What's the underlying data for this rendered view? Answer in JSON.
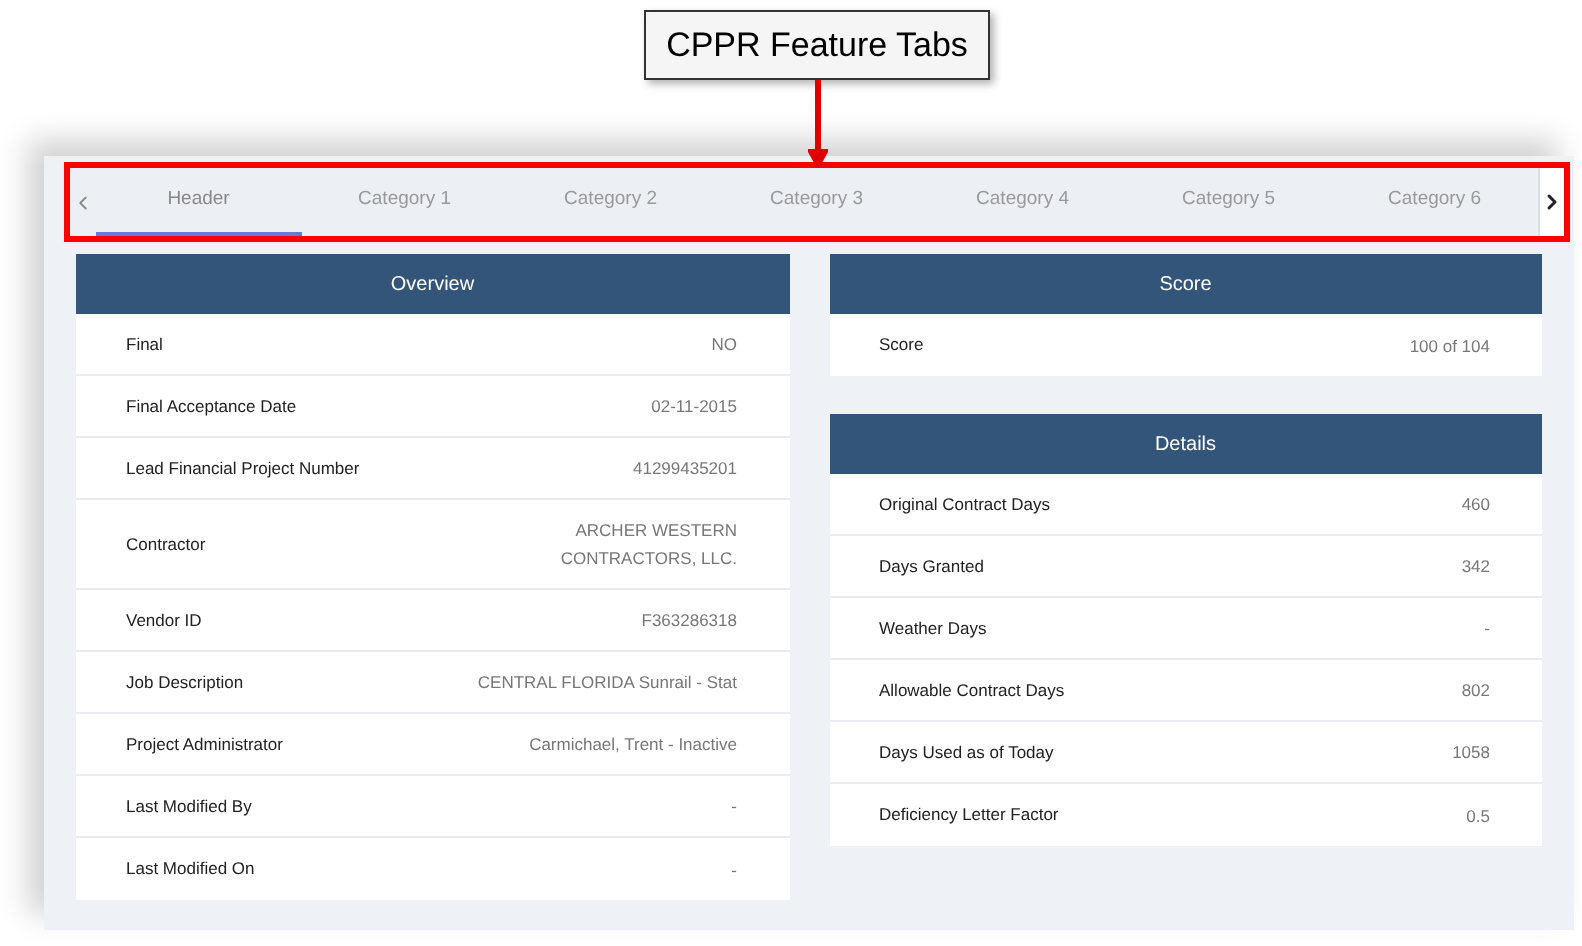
{
  "annotation": {
    "label": "CPPR Feature Tabs"
  },
  "tabs": [
    {
      "label": "Header",
      "selected": true
    },
    {
      "label": "Category 1",
      "selected": false
    },
    {
      "label": "Category 2",
      "selected": false
    },
    {
      "label": "Category 3",
      "selected": false
    },
    {
      "label": "Category 4",
      "selected": false
    },
    {
      "label": "Category 5",
      "selected": false
    },
    {
      "label": "Category 6",
      "selected": false
    }
  ],
  "overview": {
    "title": "Overview",
    "rows": [
      {
        "label": "Final",
        "value": "NO"
      },
      {
        "label": "Final Acceptance Date",
        "value": "02-11-2015"
      },
      {
        "label": "Lead Financial Project Number",
        "value": "41299435201"
      },
      {
        "label": "Contractor",
        "value": "ARCHER WESTERN CONTRACTORS, LLC."
      },
      {
        "label": "Vendor ID",
        "value": "F363286318"
      },
      {
        "label": "Job Description",
        "value": "CENTRAL FLORIDA Sunrail - Stat"
      },
      {
        "label": "Project Administrator",
        "value": "Carmichael, Trent - Inactive"
      },
      {
        "label": "Last Modified By",
        "value": "-"
      },
      {
        "label": "Last Modified On",
        "value": "-"
      }
    ]
  },
  "score": {
    "title": "Score",
    "rows": [
      {
        "label": "Score",
        "value": "100 of 104"
      }
    ]
  },
  "details": {
    "title": "Details",
    "rows": [
      {
        "label": "Original Contract Days",
        "value": "460"
      },
      {
        "label": "Days Granted",
        "value": "342"
      },
      {
        "label": "Weather Days",
        "value": "-"
      },
      {
        "label": "Allowable Contract Days",
        "value": "802"
      },
      {
        "label": "Days Used as of Today",
        "value": "1058"
      },
      {
        "label": "Deficiency Letter Factor",
        "value": "0.5"
      }
    ]
  }
}
